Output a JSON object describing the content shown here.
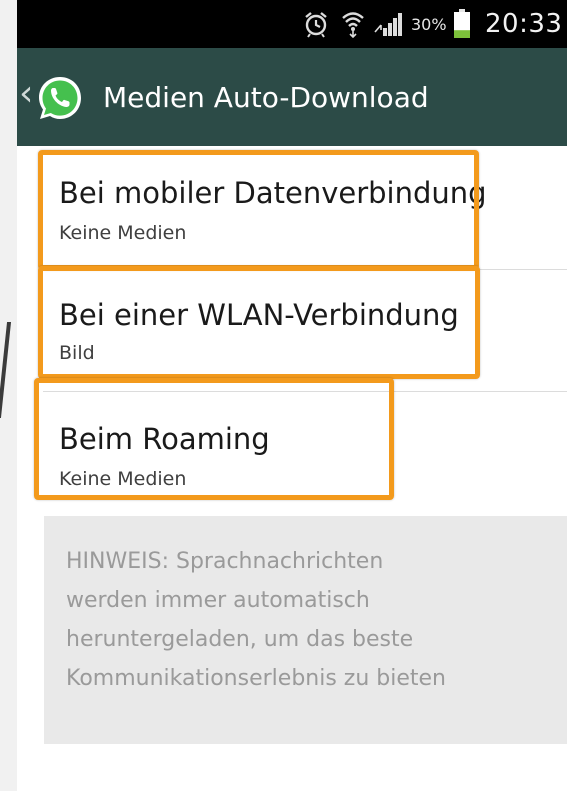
{
  "statusbar": {
    "icons": [
      "alarm-icon",
      "wifi-icon",
      "signal-icon",
      "battery-icon"
    ],
    "battery_percent": "30%",
    "battery_level": 0.3,
    "time": "20:33"
  },
  "actionbar": {
    "title": "Medien Auto-Download",
    "back_icon": "chevron-left-icon",
    "app_icon": "whatsapp-icon",
    "background_color": "#2c4b47"
  },
  "settings": [
    {
      "title": "Bei mobiler Datenverbindung",
      "value": "Keine Medien"
    },
    {
      "title": "Bei einer WLAN-Verbindung",
      "value": "Bild"
    },
    {
      "title": "Beim Roaming",
      "value": "Keine Medien"
    }
  ],
  "highlight_color": "#f39a1c",
  "note": {
    "text": "HINWEIS: Sprachnachrichten\nwerden immer automatisch\nheruntergeladen, um das beste\nKommunikationserlebnis zu bieten"
  }
}
